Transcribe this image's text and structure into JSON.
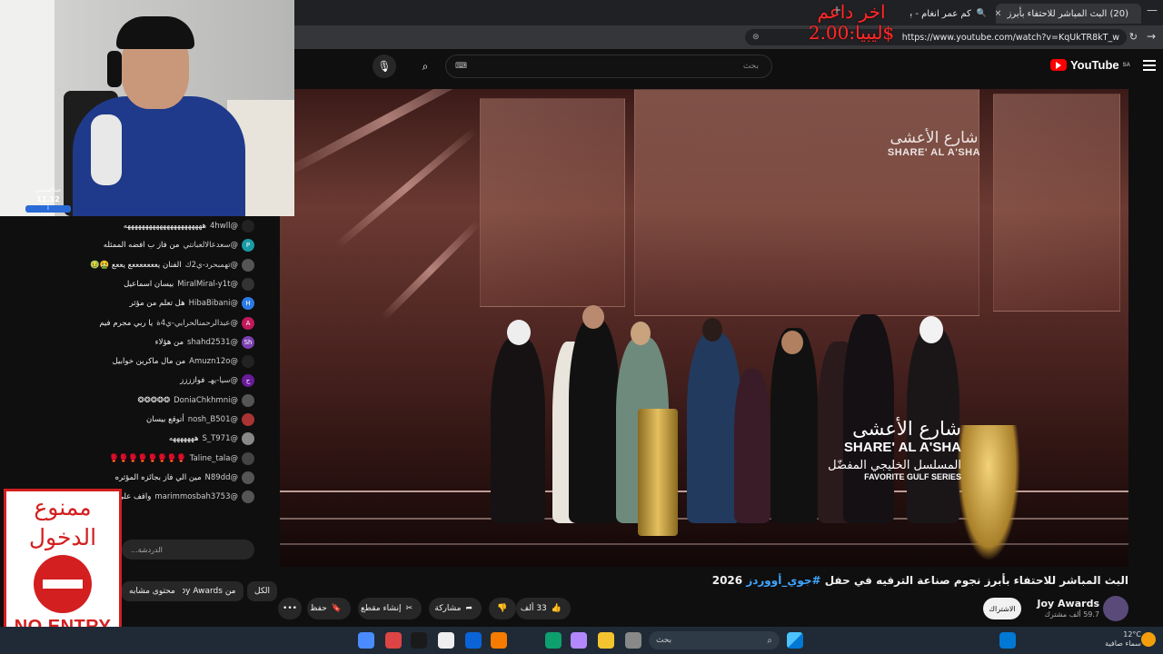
{
  "browser": {
    "tabs": [
      {
        "title": "(20) البث المباشر للاحتفاء بأبرز",
        "active": true
      },
      {
        "title": "كم عمر انغام - بحث",
        "active": false
      }
    ],
    "url": "https://www.youtube.com/watch?v=KqUkTR8kT_w",
    "new_tab": "+",
    "close": "✕",
    "minimize": "—"
  },
  "overlay": {
    "last_support_label": "اخر داعم",
    "last_support_line2": "ليبيا:2.00$"
  },
  "youtube": {
    "logo_text": "YouTube",
    "region": "SA",
    "search_placeholder": "بحث"
  },
  "video": {
    "corner_ar": "شارع الأعشى",
    "corner_en": "SHARE' AL A'SHA",
    "lower_ar": "شارع الأعشى",
    "lower_en": "SHARE' AL A'SHA",
    "category_ar": "المسلسل الخليجي المفضّل",
    "category_en": "FAVORITE GULF SERIES"
  },
  "watch": {
    "title_prefix": "البث المباشر للاحتفاء بأبرز نجوم صناعة الترفيه في حفل ",
    "title_hashtag": "#جوي_أووردز",
    "title_year": " 2026",
    "channel_name": "Joy Awards",
    "channel_subs": "59.7 ألف مشترك",
    "subscribe": "الاشتراك",
    "likes": "33 ألف",
    "share": "مشاركة",
    "clip": "إنشاء مقطع",
    "save": "حفظ",
    "more": "•••"
  },
  "chips": {
    "all": "الكل",
    "from_channel": "من Joy Awards",
    "related": "محتوى مشابه"
  },
  "chat": {
    "messages": [
      {
        "author": "@4hwll",
        "text": "ههههههههههههههههههههههه",
        "av_color": "#222"
      },
      {
        "author": "@سعدعالالعبانتي",
        "text": "من فاز ب افضه الممثله",
        "av_color": "#1a9aa5",
        "av_text": "P"
      },
      {
        "author": "@تهمبحرد-ي2ك",
        "text": "الفنان يعععععععع يععع 🤮🤢",
        "av_color": "#555"
      },
      {
        "author": "@MiralMiral-y1t",
        "text": "بيسان اسماعيل",
        "av_color": "#333"
      },
      {
        "author": "@HibaBibani",
        "text": "هل تعلم من مؤثر",
        "av_color": "#2c7be5",
        "av_text": "H"
      },
      {
        "author": "@عبدالرحمنالحرابي-ي4ة",
        "text": "يا ربي مجرم فيم",
        "av_color": "#c2185b",
        "av_text": "A"
      },
      {
        "author": "@shahd2531",
        "text": "من هؤلاء",
        "av_color": "#7b3fb0",
        "av_text": "Sh"
      },
      {
        "author": "@Amuzn12o",
        "text": "من مال ماكرين خوابيل",
        "av_color": "#222"
      },
      {
        "author": "@سيا-يهـ",
        "text": "فوازززز",
        "av_color": "#6a1b9a",
        "av_text": "ح"
      },
      {
        "author": "@DoniaChkhmni",
        "text": "❂❂❂❂❂",
        "av_color": "#555"
      },
      {
        "author": "@nosh_B501",
        "text": "أتوقع بيسان",
        "av_color": "#a33"
      },
      {
        "author": "@S_T971",
        "text": "هههههههه",
        "av_color": "#888"
      },
      {
        "author": "@Taline_tala",
        "text": "🥊🥊🥊🥊🥊🥊🥊🥊",
        "av_color": "#444"
      },
      {
        "author": "@N89dd",
        "text": "مين الي فاز بجائزه المؤثره",
        "av_color": "#555"
      },
      {
        "author": "@marimmosbah3753",
        "text": "واقف على",
        "av_color": "#555"
      }
    ],
    "input_placeholder": "الدردشة..."
  },
  "webcam": {
    "badge_line1": "عبدالمحسن",
    "badge_line2": "11.12",
    "badge_line3": "آ"
  },
  "no_entry_sign": {
    "ar_line1": "ممنوع",
    "ar_line2": "الدخول",
    "en": "NO ENTRY"
  },
  "taskbar": {
    "search_placeholder": "بحث",
    "weather_temp": "12°C",
    "weather_desc": "سماء صافية",
    "icon_colors": [
      "#4a8cff",
      "#d44",
      "#1a1a1a",
      "#eee",
      "#0a64d8",
      "#f57c00",
      "#0e9f6e",
      "#b388ff",
      "#f4c430",
      "#888",
      "#0078d4"
    ]
  }
}
